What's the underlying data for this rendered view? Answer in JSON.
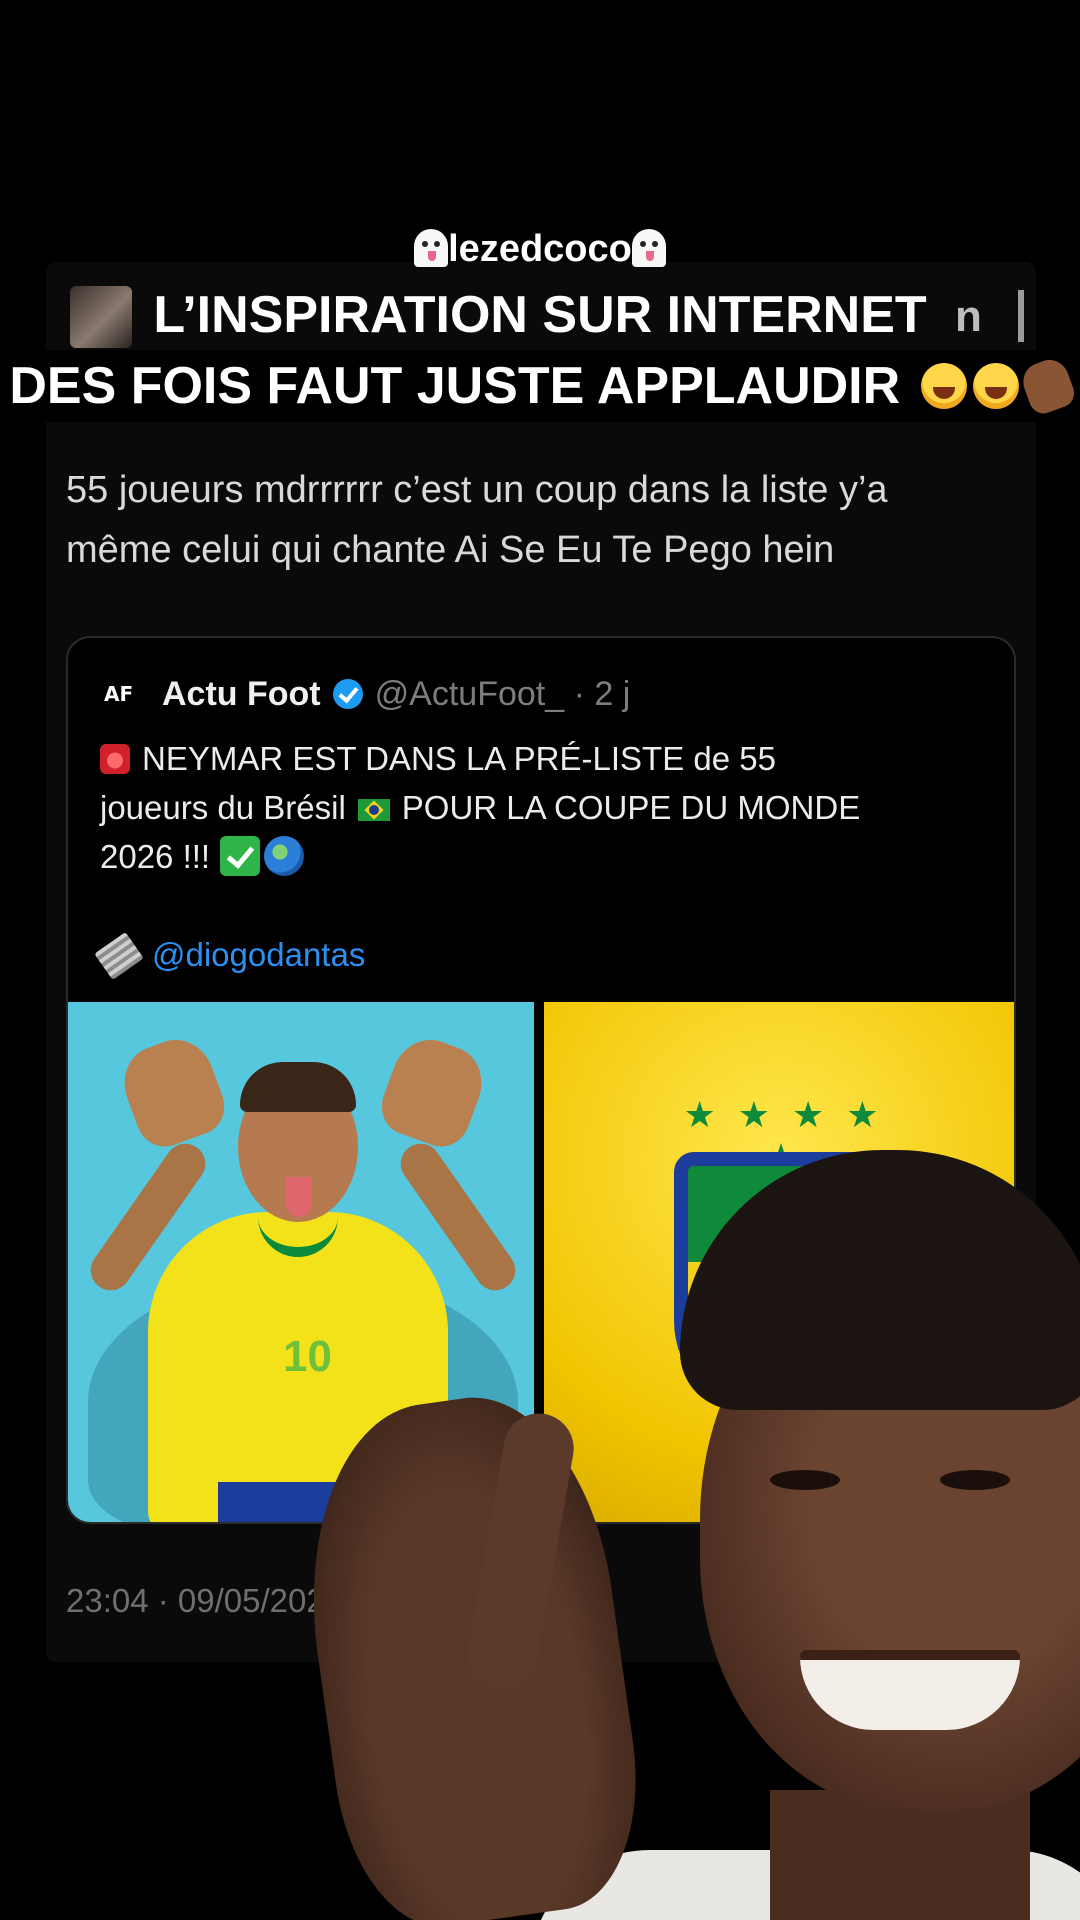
{
  "overlay": {
    "watermark": "lezedcoco",
    "caption_line1": "L’INSPIRATION SUR INTERNET",
    "caption_line2": "DES FOIS FAUT JUSTE APPLAUDIR",
    "caption_emojis": [
      "rolling-on-floor-laughing",
      "rolling-on-floor-laughing",
      "clapping-hands"
    ],
    "watermark_icon": "ghost-emoji"
  },
  "tweet": {
    "cut_name": "n",
    "text_line1": "55 joueurs mdrrrrrr c’est un coup dans la liste y’a",
    "text_line2": "même celui qui chante Ai Se Eu Te Pego hein",
    "timestamp": "23:04 · 09/05/2026 · 9"
  },
  "quote": {
    "logo_text": "AF",
    "name": "Actu Foot",
    "handle_meta": "@ActuFoot_ · 2 j",
    "body_line1": "NEYMAR EST DANS LA PRÉ-LISTE de 55",
    "body_line2a": "joueurs du Brésil",
    "body_line2b": "POUR LA COUPE DU MONDE",
    "body_line3": "2026 !!!",
    "mention": "@diogodantas",
    "icons": [
      "siren-icon",
      "brazil-flag-icon",
      "check-icon",
      "globe-icon",
      "newspaper-icon"
    ],
    "image_left": "neymar-photo",
    "image_right": "cbf-crest",
    "jersey_number": "10",
    "crest_stars": "★ ★ ★ ★ ★"
  },
  "colors": {
    "background": "#000000",
    "mention": "#2d8ff0",
    "verified": "#1d9bf0",
    "brazil_yellow": "#f3e21a",
    "brazil_green": "#0e8a3a",
    "brazil_blue": "#1c3d9c"
  }
}
